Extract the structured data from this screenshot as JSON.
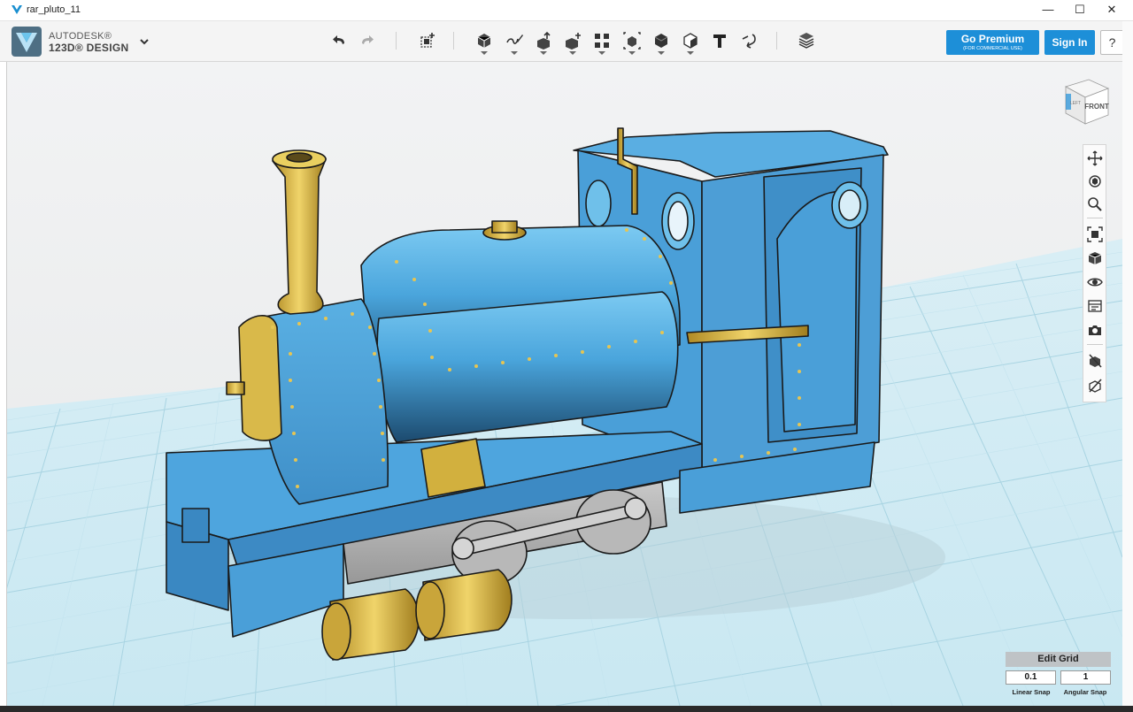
{
  "window": {
    "title": "rar_pluto_11",
    "minimize": "—",
    "maximize": "☐",
    "close": "✕"
  },
  "brand": {
    "line1": "AUTODESK®",
    "line2": "123D® DESIGN"
  },
  "toolbar": {
    "undo_icon": "undo-icon",
    "redo_icon": "redo-icon",
    "tools": [
      "transform",
      "primitives",
      "sketch",
      "construct",
      "modify",
      "pattern",
      "grouping",
      "combine",
      "measure",
      "text",
      "snap",
      "material"
    ]
  },
  "account": {
    "premium_label": "Go Premium",
    "premium_sub": "(FOR COMMERCIAL USE)",
    "signin_label": "Sign In",
    "help_label": "?"
  },
  "viewcube": {
    "face_label": "FRONT",
    "side_label": "LEFT"
  },
  "navbar": {
    "items": [
      "pan",
      "orbit",
      "zoom",
      "fit",
      "views",
      "visibility",
      "materials-outlines",
      "screenshot",
      "hide",
      "unhide"
    ]
  },
  "edit_grid": {
    "title": "Edit Grid",
    "linear_value": "0.1",
    "angular_value": "1",
    "linear_label": "Linear Snap",
    "angular_label": "Angular Snap"
  },
  "colors": {
    "accent": "#1d8fd8",
    "model_blue": "#4a9fd8",
    "brass": "#d9b94a",
    "chassis_grey": "#a8a8a8",
    "grid_line": "#a7d5e3"
  }
}
